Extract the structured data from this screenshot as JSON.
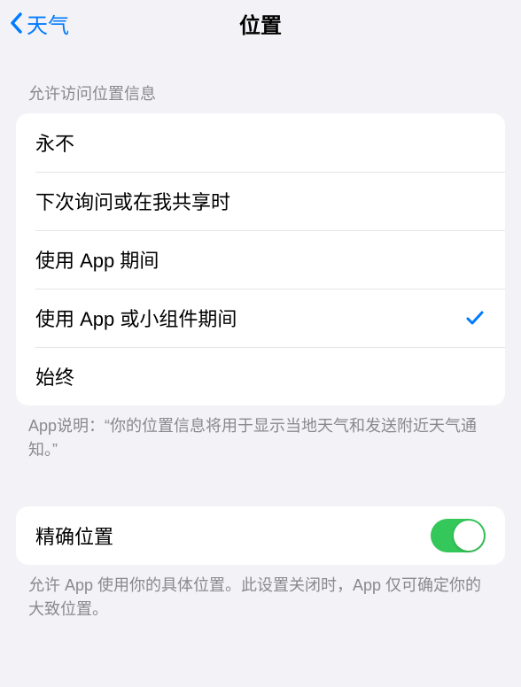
{
  "nav": {
    "back_label": "天气",
    "title": "位置"
  },
  "section1": {
    "header": "允许访问位置信息",
    "options": [
      {
        "label": "永不"
      },
      {
        "label": "下次询问或在我共享时"
      },
      {
        "label": "使用 App 期间"
      },
      {
        "label": "使用 App 或小组件期间",
        "selected": true
      },
      {
        "label": "始终"
      }
    ],
    "footer": "App说明：“你的位置信息将用于显示当地天气和发送附近天气通知。”"
  },
  "section2": {
    "precise_label": "精确位置",
    "precise_on": true,
    "footer": "允许 App 使用你的具体位置。此设置关闭时，App 仅可确定你的大致位置。"
  }
}
